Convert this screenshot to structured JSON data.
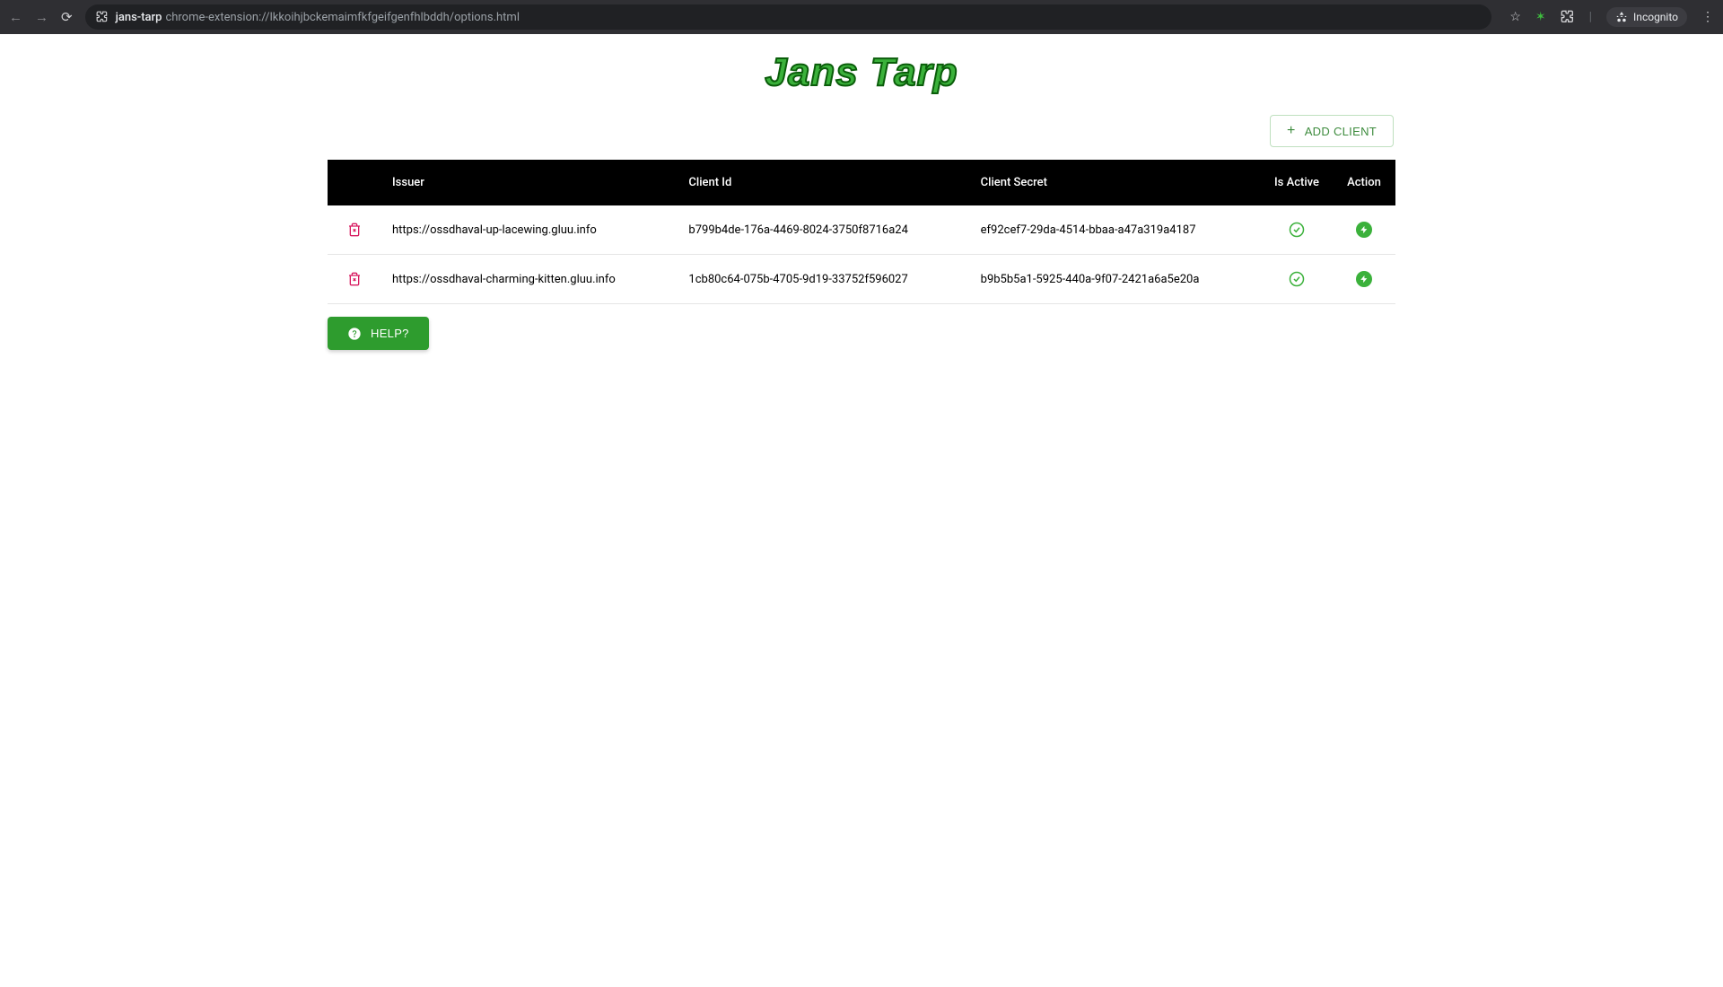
{
  "browser": {
    "tab_title": "jans-tarp",
    "url_path": "chrome-extension://lkkoihjbckemaimfkfgeifgenfhlbddh/options.html",
    "incognito_label": "Incognito"
  },
  "logo_text": "Jans Tarp",
  "add_client_label": "ADD CLIENT",
  "help_label": "HELP?",
  "table": {
    "headers": {
      "del": "",
      "issuer": "Issuer",
      "client_id": "Client Id",
      "client_secret": "Client Secret",
      "is_active": "Is Active",
      "action": "Action"
    },
    "rows": [
      {
        "issuer": "https://ossdhaval-up-lacewing.gluu.info",
        "client_id": "b799b4de-176a-4469-8024-3750f8716a24",
        "client_secret": "ef92cef7-29da-4514-bbaa-a47a319a4187"
      },
      {
        "issuer": "https://ossdhaval-charming-kitten.gluu.info",
        "client_id": "1cb80c64-075b-4705-9d19-33752f596027",
        "client_secret": "b9b5b5a1-5925-440a-9f07-2421a6a5e20a"
      }
    ]
  }
}
